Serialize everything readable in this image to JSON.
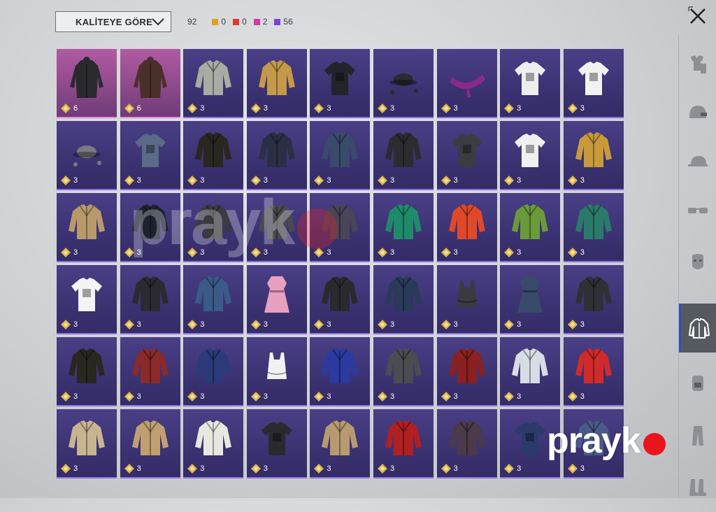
{
  "sort": {
    "label": "KALİTEYE GÖRE"
  },
  "counts": {
    "total": "92",
    "qualities": [
      {
        "color": "#e0a020",
        "value": "0"
      },
      {
        "color": "#e03a2a",
        "value": "0"
      },
      {
        "color": "#d43aa8",
        "value": "2"
      },
      {
        "color": "#7a44d8",
        "value": "56"
      }
    ]
  },
  "watermark": {
    "text": "prayk"
  },
  "sidebar": [
    {
      "icon": "outfit-icon"
    },
    {
      "icon": "helmet-icon"
    },
    {
      "icon": "cap-icon"
    },
    {
      "icon": "glasses-icon"
    },
    {
      "icon": "mask-icon"
    },
    {
      "icon": "jacket-icon",
      "active": true
    },
    {
      "icon": "backpack-icon"
    },
    {
      "icon": "pants-icon"
    },
    {
      "icon": "boots-icon"
    }
  ],
  "items": [
    {
      "q": "mythic",
      "c": "6",
      "color": "#2a2a2e",
      "shape": "coat"
    },
    {
      "q": "mythic",
      "c": "6",
      "color": "#4a2f2a",
      "shape": "coat"
    },
    {
      "q": "epic",
      "c": "3",
      "color": "#a8aca2",
      "shape": "jacket"
    },
    {
      "q": "epic",
      "c": "3",
      "color": "#c49a4a",
      "shape": "jacket"
    },
    {
      "q": "epic",
      "c": "3",
      "color": "#22242a",
      "shape": "shirt"
    },
    {
      "q": "epic",
      "c": "3",
      "color": "#2a2a30",
      "shape": "hat"
    },
    {
      "q": "epic",
      "c": "3",
      "color": "#8a2a8a",
      "shape": "scarf"
    },
    {
      "q": "epic",
      "c": "3",
      "color": "#eeeeee",
      "shape": "shirt"
    },
    {
      "q": "epic",
      "c": "3",
      "color": "#f2f2f2",
      "shape": "shirt"
    },
    {
      "q": "epic",
      "c": "3",
      "color": "#7a7a80",
      "shape": "hat"
    },
    {
      "q": "epic",
      "c": "3",
      "color": "#5a6a88",
      "shape": "shirt"
    },
    {
      "q": "epic",
      "c": "3",
      "color": "#2a2620",
      "shape": "jacket"
    },
    {
      "q": "epic",
      "c": "3",
      "color": "#2a2f44",
      "shape": "jacket"
    },
    {
      "q": "epic",
      "c": "3",
      "color": "#3a4a6a",
      "shape": "jacket"
    },
    {
      "q": "epic",
      "c": "3",
      "color": "#2c2c30",
      "shape": "jacket"
    },
    {
      "q": "epic",
      "c": "3",
      "color": "#3a3c40",
      "shape": "shirt"
    },
    {
      "q": "epic",
      "c": "3",
      "color": "#f0f0f0",
      "shape": "shirt"
    },
    {
      "q": "epic",
      "c": "3",
      "color": "#c89a3a",
      "shape": "jacket"
    },
    {
      "q": "epic",
      "c": "3",
      "color": "#b89a6a",
      "shape": "jacket"
    },
    {
      "q": "epic",
      "c": "3",
      "color": "#1e2230",
      "shape": "jacket"
    },
    {
      "q": "epic",
      "c": "3",
      "color": "#3a3a40",
      "shape": "jacket"
    },
    {
      "q": "epic",
      "c": "3",
      "color": "#4a4a50",
      "shape": "jacket"
    },
    {
      "q": "epic",
      "c": "3",
      "color": "#4a4458",
      "shape": "jacket"
    },
    {
      "q": "epic",
      "c": "3",
      "color": "#1f8a6a",
      "shape": "jacket"
    },
    {
      "q": "epic",
      "c": "3",
      "color": "#e0482a",
      "shape": "jacket"
    },
    {
      "q": "epic",
      "c": "3",
      "color": "#6a9a3a",
      "shape": "jacket"
    },
    {
      "q": "epic",
      "c": "3",
      "color": "#2a7a6a",
      "shape": "jacket"
    },
    {
      "q": "epic",
      "c": "3",
      "color": "#f4f4f4",
      "shape": "shirt"
    },
    {
      "q": "epic",
      "c": "3",
      "color": "#2a2a30",
      "shape": "jacket"
    },
    {
      "q": "epic",
      "c": "3",
      "color": "#3a5a8a",
      "shape": "jacket"
    },
    {
      "q": "epic",
      "c": "3",
      "color": "#e8a0c0",
      "shape": "dress"
    },
    {
      "q": "epic",
      "c": "3",
      "color": "#2a2a2e",
      "shape": "jacket"
    },
    {
      "q": "epic",
      "c": "3",
      "color": "#2a3a5a",
      "shape": "jacket"
    },
    {
      "q": "epic",
      "c": "3",
      "color": "#3a3a40",
      "shape": "top"
    },
    {
      "q": "epic",
      "c": "3",
      "color": "#3a4a6a",
      "shape": "dress"
    },
    {
      "q": "epic",
      "c": "3",
      "color": "#2f3036",
      "shape": "jacket"
    },
    {
      "q": "epic",
      "c": "3",
      "color": "#2a2620",
      "shape": "jacket"
    },
    {
      "q": "epic",
      "c": "3",
      "color": "#8a2a2a",
      "shape": "jacket"
    },
    {
      "q": "epic",
      "c": "3",
      "color": "#2a3a7a",
      "shape": "jacket"
    },
    {
      "q": "epic",
      "c": "3",
      "color": "#f2f2f2",
      "shape": "top"
    },
    {
      "q": "epic",
      "c": "3",
      "color": "#2a3aa0",
      "shape": "jacket"
    },
    {
      "q": "epic",
      "c": "3",
      "color": "#4a4c50",
      "shape": "jacket"
    },
    {
      "q": "epic",
      "c": "3",
      "color": "#8a2020",
      "shape": "jacket"
    },
    {
      "q": "epic",
      "c": "3",
      "color": "#d8dce4",
      "shape": "jacket"
    },
    {
      "q": "epic",
      "c": "3",
      "color": "#d02a2a",
      "shape": "jacket"
    },
    {
      "q": "epic",
      "c": "3",
      "color": "#c8b490",
      "shape": "jacket"
    },
    {
      "q": "epic",
      "c": "3",
      "color": "#c0a070",
      "shape": "jacket"
    },
    {
      "q": "epic",
      "c": "3",
      "color": "#e8e8e0",
      "shape": "jacket"
    },
    {
      "q": "epic",
      "c": "3",
      "color": "#2a2a2e",
      "shape": "shirt"
    },
    {
      "q": "epic",
      "c": "3",
      "color": "#b89a70",
      "shape": "jacket"
    },
    {
      "q": "epic",
      "c": "3",
      "color": "#b02020",
      "shape": "jacket"
    },
    {
      "q": "epic",
      "c": "3",
      "color": "#4a3a4a",
      "shape": "jacket"
    },
    {
      "q": "epic",
      "c": "3",
      "color": "#2a3a6a",
      "shape": "shirt"
    },
    {
      "q": "epic",
      "c": "3",
      "color": "#4a5a8a",
      "shape": "jacket"
    }
  ]
}
